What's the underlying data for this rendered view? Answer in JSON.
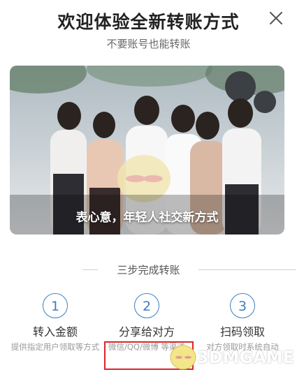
{
  "header": {
    "title": "欢迎体验全新转账方式",
    "subtitle": "不要账号也能转账"
  },
  "banner": {
    "caption": "表心意，年轻人社交新方式"
  },
  "steps_section": {
    "heading": "三步完成转账",
    "steps": [
      {
        "number": "1",
        "title": "转入金额",
        "desc": "提供指定用户领取等方式"
      },
      {
        "number": "2",
        "title": "分享给对方",
        "desc": "微信/QQ/微博 等渠道"
      },
      {
        "number": "3",
        "title": "扫码领取",
        "desc": "对方领取时系统自动"
      }
    ]
  },
  "watermark": {
    "text": "3DMGAME"
  },
  "colors": {
    "accent": "#3d7ec2",
    "highlight_box": "#d9262c"
  }
}
